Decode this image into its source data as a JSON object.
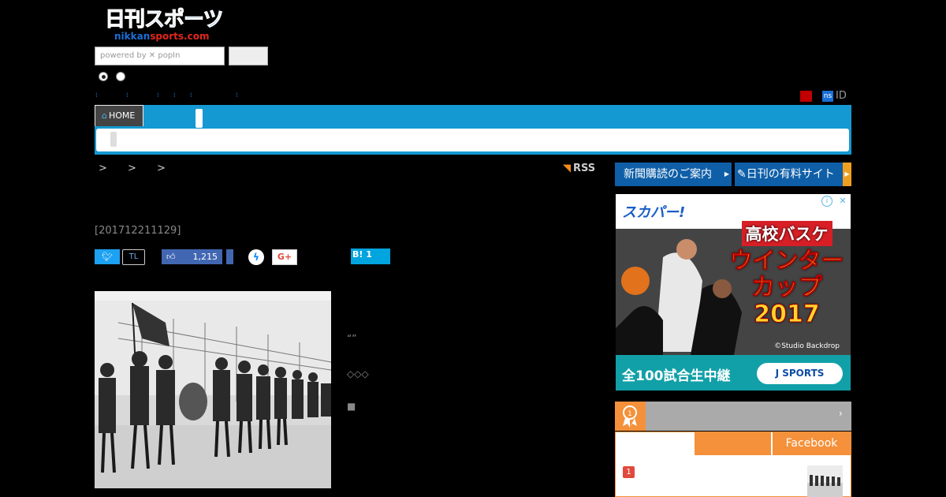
{
  "header": {
    "logo_jp": "日刊スポーツ",
    "logo_en_a": "nikkan",
    "logo_en_b": "sports.com",
    "search_placeholder": "powered by ✕ popIn",
    "id_label": "ID",
    "ns_badge": "ns"
  },
  "nav": {
    "home_label": "HOME"
  },
  "breadcrumb": {
    "text": "> > >"
  },
  "rss_label": "RSS",
  "article": {
    "date": "[201712211129]",
    "text_lines": [
      "“”",
      "◇◇◇",
      "■"
    ]
  },
  "share": {
    "tl_label": "TL",
    "fb_like_count": "1,215",
    "gplus_label": "G+",
    "hatena_label": "B! 1"
  },
  "sidebar": {
    "subscribe_label": "新聞購読のご案内",
    "paid_site_label": "日刊の有料サイト",
    "ranking_tab_fb": "Facebook",
    "ranking_first_num": "1"
  },
  "ad": {
    "brand": "スカパー!",
    "title_1": "高校バスケ",
    "title_2": "ウインター",
    "title_3": "カップ",
    "title_4": "2017",
    "credit": "©Studio Backdrop",
    "bottom_text": "全100試合生中継",
    "cta": "J SPORTS"
  },
  "colors": {
    "nav_blue": "#1499d2",
    "ranking_orange": "#f5913a",
    "subscribe_blue": "#0f5fa8"
  }
}
